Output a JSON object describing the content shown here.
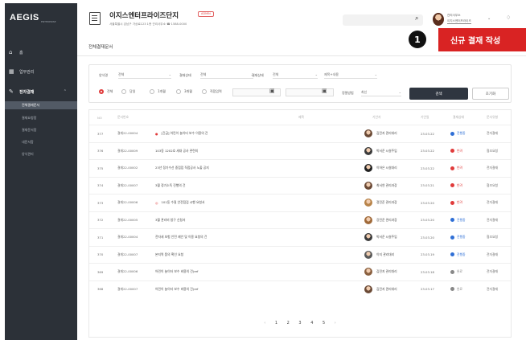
{
  "sidebar": {
    "logo": "AEGIS",
    "logo_sub": "ENTERPRISE",
    "items": [
      {
        "label": "홈",
        "icon": "home-icon"
      },
      {
        "label": "업무관리",
        "icon": "grid-icon"
      },
      {
        "label": "전자결재",
        "icon": "approval-icon"
      }
    ],
    "subitems": [
      {
        "label": "전체결재문서",
        "active": true
      },
      {
        "label": "결재요청함",
        "active": false
      },
      {
        "label": "결재문서함",
        "active": false
      },
      {
        "label": "내문서함",
        "active": false
      },
      {
        "label": "양식관리",
        "active": false
      }
    ]
  },
  "header": {
    "org_name": "이지스엔터프라이즈단지",
    "org_badge": "ADMIN",
    "org_address": "서울특별시 강남구 가상로123 1층 관리사무소 ☎ 1588-0000",
    "user_name": "관리사무소",
    "user_dept": "이지스엔터프라이즈",
    "search_icon": "search-icon",
    "bell_icon": "bell-icon"
  },
  "page": {
    "title": "전체결재문서",
    "callout_number": "1",
    "callout_label": "신규 결재 작성"
  },
  "filters": {
    "doc_type_label": "양식명",
    "doc_type_value": "전체",
    "status_label": "결재상태",
    "status_value": "전체",
    "drafter_label": "결재상태",
    "drafter_value": "전체",
    "keyword_placeholder": "제목+내용",
    "period_options": [
      "전체",
      "당일",
      "1개월",
      "3개월",
      "직접입력"
    ],
    "period_selected": "전체",
    "sort_label": "정렬방법",
    "sort_value": "최신",
    "search_button": "검색",
    "reset_button": "초기화"
  },
  "table": {
    "headers": [
      "NO",
      "문서번호",
      "제목",
      "기안자",
      "기안일",
      "결재상태",
      "문서유형"
    ],
    "rows": [
      {
        "no": "377",
        "doc_no": "결재22-00004",
        "title": "[긴급] 어린이 놀이터 보수 이용의 건",
        "mark": "●",
        "mark_color": "#e03b3b",
        "user": "김민지 관리대리",
        "date": "23.03.22",
        "status": "진행중",
        "status_color": "#2f6fd6",
        "type": "전자결재"
      },
      {
        "no": "376",
        "doc_no": "결재22-00009",
        "title": "103동 1202호 세대 공사 관련의",
        "mark": "",
        "mark_color": "",
        "user": "박서준 시설주임",
        "date": "23.03.22",
        "status": "반려",
        "status_color": "#e03b3b",
        "type": "협조요청"
      },
      {
        "no": "375",
        "doc_no": "결재22-00002",
        "title": "23년 정기수선 중점점 직접공사 노출 공지",
        "mark": "",
        "mark_color": "",
        "user": "이하은 시설대리",
        "date": "23.03.22",
        "status": "반려",
        "status_color": "#e03b3b",
        "type": "전자결재"
      },
      {
        "no": "374",
        "doc_no": "결재22-00007",
        "title": "3월 정기소독 진행의 건",
        "mark": "",
        "mark_color": "",
        "user": "최서연 관리과장",
        "date": "23.03.21",
        "status": "반려",
        "status_color": "#e03b3b",
        "type": "협조요청"
      },
      {
        "no": "373",
        "doc_no": "결재22-00006",
        "title": "101동 수질 안전점검 시행 요청서",
        "mark": "◎",
        "mark_color": "#e03b3b",
        "user": "정민준 관리과장",
        "date": "23.03.20",
        "status": "반려",
        "status_color": "#e03b3b",
        "type": "전자결재"
      },
      {
        "no": "372",
        "doc_no": "결재22-00005",
        "title": "3월 관리비 청구 신청서",
        "mark": "",
        "mark_color": "",
        "user": "강민준 관리과장",
        "date": "23.03.20",
        "status": "진행중",
        "status_color": "#2f6fd6",
        "type": "전자결재"
      },
      {
        "no": "371",
        "doc_no": "결재22-00004",
        "title": "전자세 보험 안전 제안 및 이용 요청의 건",
        "mark": "",
        "mark_color": "",
        "user": "박서준 시설주임",
        "date": "23.03.20",
        "status": "진행중",
        "status_color": "#2f6fd6",
        "type": "협조요청"
      },
      {
        "no": "370",
        "doc_no": "결재22-00007",
        "title": "본지역 품의 확인 요청",
        "mark": "",
        "mark_color": "",
        "user": "이지 관리대리",
        "date": "23.03.19",
        "status": "진행중",
        "status_color": "#2f6fd6",
        "type": "전자결재"
      },
      {
        "no": "369",
        "doc_no": "결재22-00006",
        "title": "어린이 놀이터 보수 비용의 건(ref",
        "mark": "",
        "mark_color": "",
        "user": "김민지 관리대리",
        "date": "23.03.18",
        "status": "완료",
        "status_color": "#888888",
        "type": "전자결재"
      },
      {
        "no": "368",
        "doc_no": "결재22-00007",
        "title": "어린이 놀이터 보수 비용의 건(ref",
        "mark": "",
        "mark_color": "",
        "user": "김민지 관리대리",
        "date": "23.03.17",
        "status": "완료",
        "status_color": "#888888",
        "type": "전자결재"
      }
    ],
    "avatar_colors": [
      "#6b4a36",
      "#3c3c3c",
      "#222222",
      "#6b4a36",
      "#b8844a",
      "#a06a3a",
      "#3c3c3c",
      "#5a5a5a",
      "#8a6040",
      "#6b4a36"
    ]
  },
  "pagination": {
    "prev": "‹",
    "pages": [
      "1",
      "2",
      "3",
      "4",
      "5"
    ],
    "next": "›"
  }
}
